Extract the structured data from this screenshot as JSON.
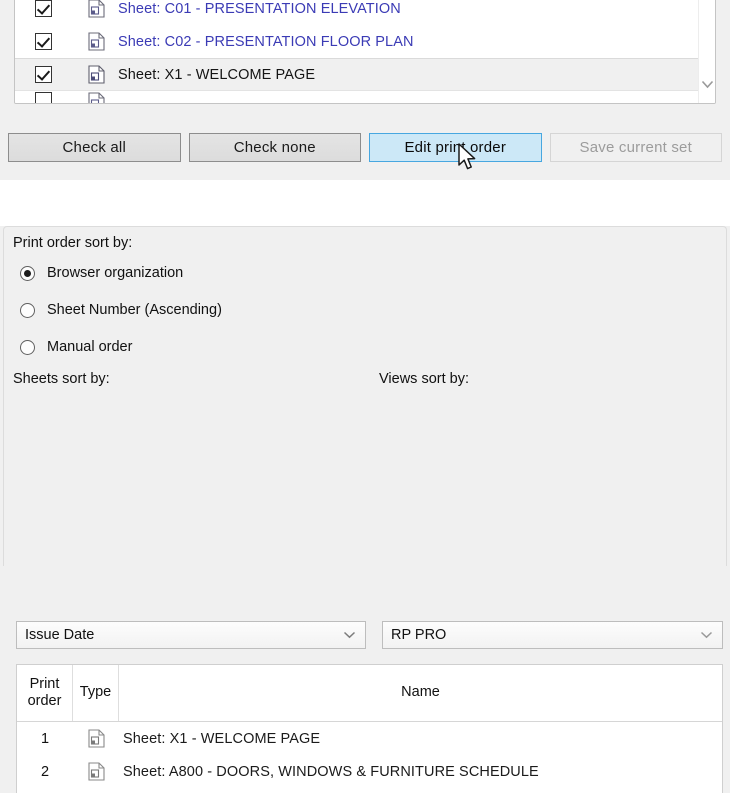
{
  "sheet_list": {
    "rows": [
      {
        "checked": true,
        "icon": "sheet-icon",
        "label": "Sheet: C01 - PRESENTATION ELEVATION",
        "style": "link",
        "selected": false
      },
      {
        "checked": true,
        "icon": "sheet-icon",
        "label": "Sheet: C02 - PRESENTATION FLOOR PLAN",
        "style": "link",
        "selected": false
      },
      {
        "checked": true,
        "icon": "sheet-icon",
        "label": "Sheet: X1 - WELCOME PAGE",
        "style": "plain",
        "selected": true
      }
    ],
    "scrollbar": {
      "down_arrow_icon": "chevron-down-icon"
    },
    "link_color": "#3b3bb5",
    "selected_row_bg": "#f0f0f0"
  },
  "buttons": [
    {
      "label": "Check all",
      "state": "normal"
    },
    {
      "label": "Check none",
      "state": "normal"
    },
    {
      "label": "Edit print order",
      "state": "hover"
    },
    {
      "label": "Save current set",
      "state": "disabled"
    }
  ],
  "print_order": {
    "sort_by_label": "Print order sort by:",
    "radios": [
      {
        "label": "Browser organization",
        "selected": true
      },
      {
        "label": "Sheet Number (Ascending)",
        "selected": false
      },
      {
        "label": "Manual order",
        "selected": false
      }
    ],
    "sheets_sort": {
      "label": "Sheets sort by:",
      "value": "Issue Date",
      "chevron": "chevron-down-icon"
    },
    "views_sort": {
      "label": "Views sort by:",
      "value": "RP PRO",
      "chevron": "chevron-down-icon"
    },
    "table": {
      "headers": {
        "print_order": "Print order",
        "type": "Type",
        "name": "Name"
      },
      "rows": [
        {
          "order": "1",
          "icon": "sheet-icon",
          "name": "Sheet: X1 - WELCOME PAGE"
        },
        {
          "order": "2",
          "icon": "sheet-icon",
          "name": "Sheet: A800 - DOORS, WINDOWS & FURNITURE SCHEDULE"
        }
      ]
    }
  },
  "cursor": {
    "icon": "mouse-pointer-icon"
  },
  "colors": {
    "hover_button_bg": "#cce8f7",
    "hover_button_border": "#47a7e0",
    "panel_bg": "#f0f0f0",
    "disabled_text": "#9c9c9c"
  }
}
